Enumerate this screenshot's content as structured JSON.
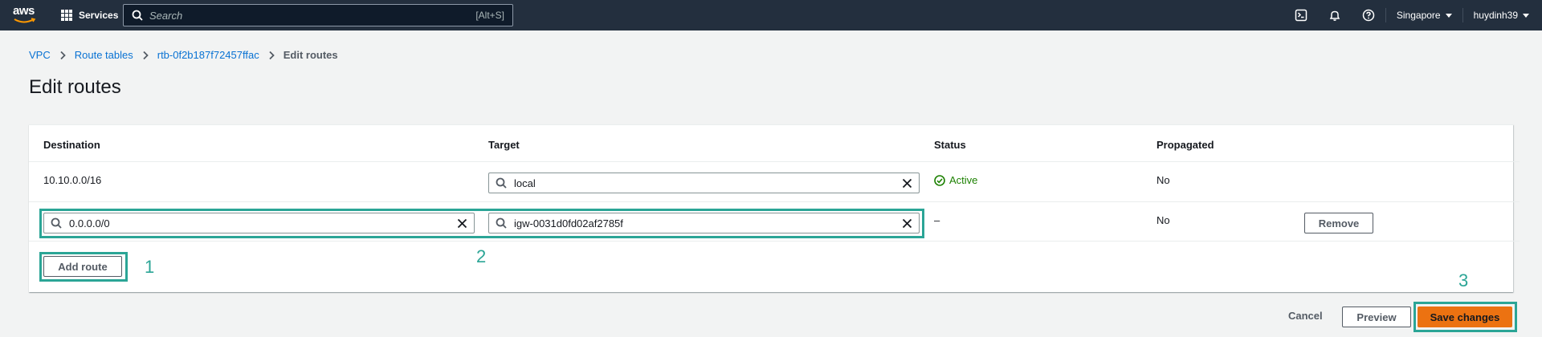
{
  "nav": {
    "logo_text": "aws",
    "services_label": "Services",
    "search_placeholder": "Search",
    "search_shortcut": "[Alt+S]",
    "region_label": "Singapore",
    "user_label": "huydinh39"
  },
  "breadcrumb": {
    "items": [
      "VPC",
      "Route tables",
      "rtb-0f2b187f72457ffac"
    ],
    "current": "Edit routes"
  },
  "page": {
    "title": "Edit routes"
  },
  "table": {
    "headers": {
      "destination": "Destination",
      "target": "Target",
      "status": "Status",
      "propagated": "Propagated"
    },
    "rows": [
      {
        "destination": "10.10.0.0/16",
        "target": "local",
        "status": "Active",
        "propagated": "No"
      },
      {
        "destination": "0.0.0.0/0",
        "target": "igw-0031d0fd02af2785f",
        "status": "–",
        "propagated": "No",
        "remove_label": "Remove"
      }
    ],
    "add_route_label": "Add route"
  },
  "footer": {
    "cancel_label": "Cancel",
    "preview_label": "Preview",
    "save_label": "Save changes"
  },
  "annotations": [
    "1",
    "2",
    "3"
  ],
  "colors": {
    "nav_bg": "#232f3e",
    "link": "#0972d3",
    "primary": "#ec7211",
    "active_status": "#1d8102",
    "annotation": "#2ba596"
  }
}
